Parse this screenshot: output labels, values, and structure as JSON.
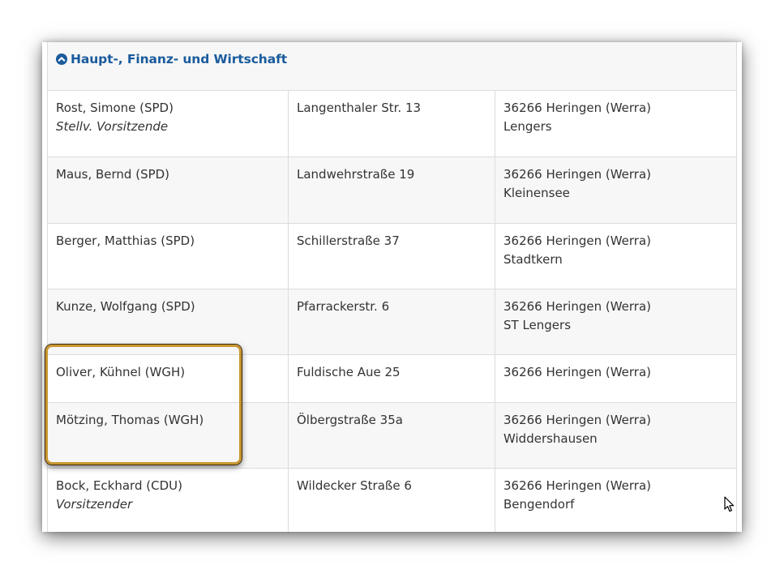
{
  "section": {
    "title": "Haupt-, Finanz- und Wirtschaft",
    "icon": "chevron-up-circle-icon"
  },
  "rows": [
    {
      "name": "Rost, Simone (SPD)",
      "role": "Stellv. Vorsitzende",
      "street": "Langenthaler Str. 13",
      "city": "36266 Heringen (Werra)",
      "district": "Lengers"
    },
    {
      "name": "Maus, Bernd (SPD)",
      "role": "",
      "street": "Landwehrstraße 19",
      "city": "36266 Heringen (Werra)",
      "district": "Kleinensee"
    },
    {
      "name": "Berger, Matthias (SPD)",
      "role": "",
      "street": "Schillerstraße 37",
      "city": "36266 Heringen (Werra)",
      "district": "Stadtkern"
    },
    {
      "name": "Kunze, Wolfgang (SPD)",
      "role": "",
      "street": "Pfarrackerstr. 6",
      "city": "36266 Heringen (Werra)",
      "district": "ST Lengers"
    },
    {
      "name": "Oliver, Kühnel (WGH)",
      "role": "",
      "street": "Fuldische Aue 25",
      "city": "36266 Heringen (Werra)",
      "district": ""
    },
    {
      "name": "Mötzing, Thomas (WGH)",
      "role": "",
      "street": "Ölbergstraße 35a",
      "city": "36266 Heringen (Werra)",
      "district": "Widdershausen"
    },
    {
      "name": "Bock, Eckhard (CDU)",
      "role": "Vorsitzender",
      "street": "Wildecker Straße 6",
      "city": "36266 Heringen (Werra)",
      "district": "Bengendorf"
    }
  ],
  "colors": {
    "accent": "#1a5b9c",
    "highlight": "#c8962f"
  }
}
